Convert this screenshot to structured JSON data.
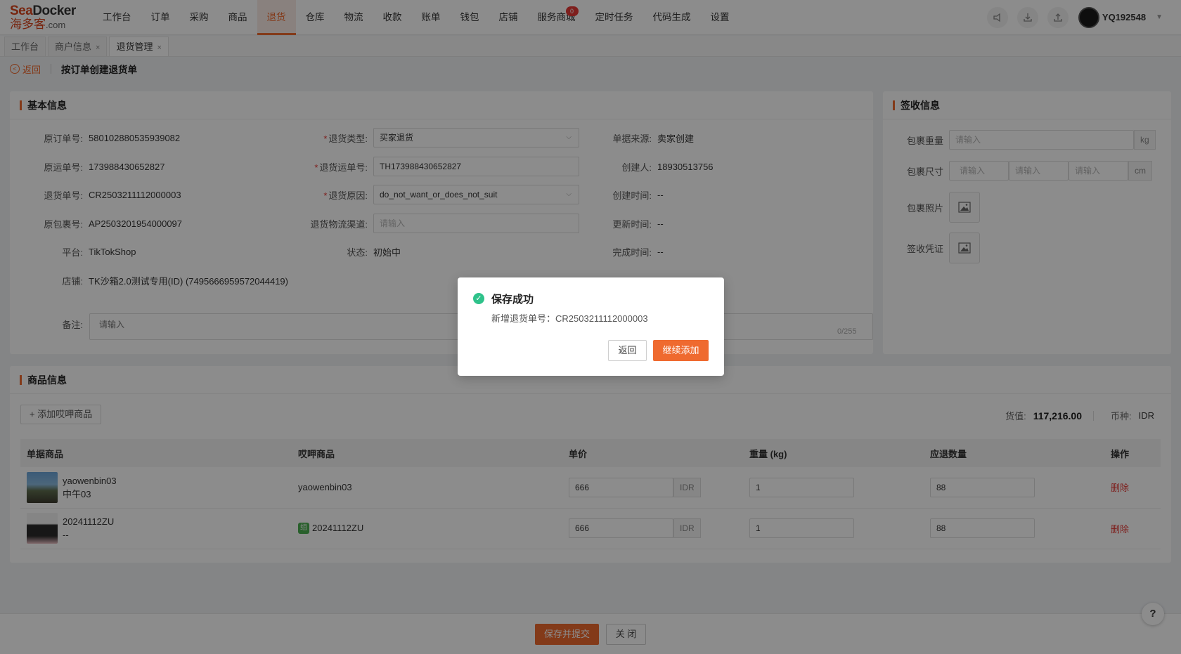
{
  "brand": {
    "top_a": "Sea",
    "top_b": "Docker",
    "cn": "海多客",
    "dot": ".com"
  },
  "nav": {
    "items": [
      "工作台",
      "订单",
      "采购",
      "商品",
      "退货",
      "仓库",
      "物流",
      "收款",
      "账单",
      "钱包",
      "店铺",
      "服务商城",
      "定时任务",
      "代码生成",
      "设置"
    ],
    "active": "退货",
    "badge": "0",
    "username": "YQ192548"
  },
  "tabs": [
    {
      "label": "工作台",
      "closable": false
    },
    {
      "label": "商户信息",
      "closable": true
    },
    {
      "label": "退货管理",
      "closable": true
    }
  ],
  "tab_close": "×",
  "breadcrumb": {
    "back": "返回",
    "title": "按订单创建退货单"
  },
  "basic": {
    "title": "基本信息",
    "col1": [
      {
        "label": "原订单号:",
        "value": "580102880535939082"
      },
      {
        "label": "原运单号:",
        "value": "173988430652827"
      },
      {
        "label": "退货单号:",
        "value": "CR2503211112000003"
      },
      {
        "label": "原包裹号:",
        "value": "AP2503201954000097"
      },
      {
        "label": "平台:",
        "value": "TikTokShop"
      },
      {
        "label": "店铺:",
        "value": "TK沙箱2.0测试专用(ID) (7495666959572044419)"
      }
    ],
    "col2": [
      {
        "label": "退货类型:",
        "required": true,
        "value": "买家退货",
        "kind": "select"
      },
      {
        "label": "退货运单号:",
        "required": true,
        "value": "TH173988430652827",
        "kind": "input"
      },
      {
        "label": "退货原因:",
        "required": true,
        "value": "do_not_want_or_does_not_suit",
        "kind": "select"
      },
      {
        "label": "退货物流渠道:",
        "required": false,
        "value": "请输入",
        "kind": "placeholder"
      },
      {
        "label": "状态:",
        "required": false,
        "value": "初始中",
        "kind": "text"
      }
    ],
    "col3": [
      {
        "label": "单据来源:",
        "value": "卖家创建"
      },
      {
        "label": "创建人:",
        "value": "18930513756"
      },
      {
        "label": "创建时间:",
        "value": "--"
      },
      {
        "label": "更新时间:",
        "value": "--"
      },
      {
        "label": "完成时间:",
        "value": "--"
      }
    ],
    "remark_label": "备注:",
    "remark_placeholder": "请输入",
    "remark_counter": "0/255",
    "required_mark": "*"
  },
  "receipt": {
    "title": "签收信息",
    "weight_label": "包裹重量",
    "weight_placeholder": "请输入",
    "weight_unit": "kg",
    "size_label": "包裹尺寸",
    "size_placeholder": "请输入",
    "size_unit": "cm",
    "photo_label": "包裹照片",
    "proof_label": "签收凭证"
  },
  "products": {
    "title": "商品信息",
    "add_button": "+ 添加哎呷商品",
    "value_label": "货值:",
    "value": "117,216.00",
    "currency_label": "币种:",
    "currency": "IDR",
    "columns": [
      "单据商品",
      "哎呷商品",
      "单价",
      "重量 (kg)",
      "应退数量",
      "操作"
    ],
    "rows": [
      {
        "sku": "yaowenbin03",
        "sub": "中午03",
        "matched": "yaowenbin03",
        "tagged": false,
        "price": "666",
        "currency": "IDR",
        "weight": "1",
        "qty": "88",
        "action": "删除"
      },
      {
        "sku": "20241112ZU",
        "sub": "--",
        "matched": "20241112ZU",
        "tagged": true,
        "tag": "组",
        "price": "666",
        "currency": "IDR",
        "weight": "1",
        "qty": "88",
        "action": "删除"
      }
    ]
  },
  "footer": {
    "submit": "保存并提交",
    "close": "关 闭"
  },
  "help": "?",
  "modal": {
    "title": "保存成功",
    "message": "新增退货单号：CR2503211112000003",
    "cancel": "返回",
    "confirm": "继续添加",
    "icon": "check-circle-icon"
  },
  "colors": {
    "accent": "#ef6a2f",
    "success": "#2ec28a",
    "danger": "#e53935"
  }
}
